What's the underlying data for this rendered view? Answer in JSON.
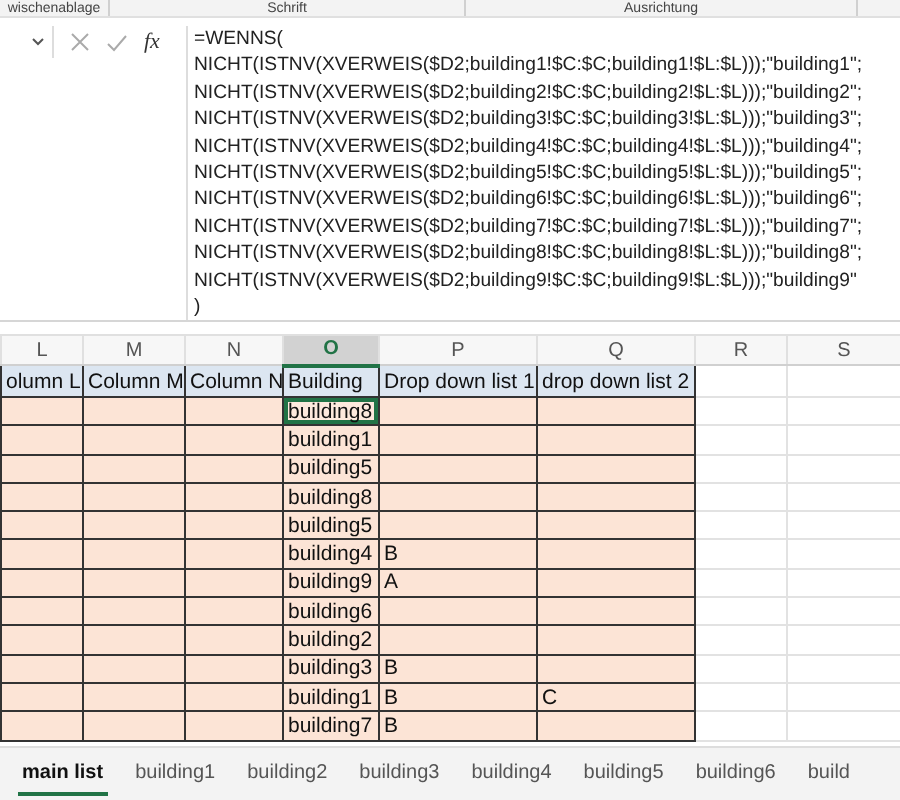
{
  "ribbon_groups": [
    "wischenablage",
    "Schrift",
    "Ausrichtung"
  ],
  "formula_bar": {
    "function_button": "fx",
    "formula_lines": [
      "=WENNS(",
      "NICHT(ISTNV(XVERWEIS($D2;building1!$C:$C;building1!$L:$L)));\"building1\";",
      "NICHT(ISTNV(XVERWEIS($D2;building2!$C:$C;building2!$L:$L)));\"building2\";",
      "NICHT(ISTNV(XVERWEIS($D2;building3!$C:$C;building3!$L:$L)));\"building3\";",
      "NICHT(ISTNV(XVERWEIS($D2;building4!$C:$C;building4!$L:$L)));\"building4\";",
      "NICHT(ISTNV(XVERWEIS($D2;building5!$C:$C;building5!$L:$L)));\"building5\";",
      "NICHT(ISTNV(XVERWEIS($D2;building6!$C:$C;building6!$L:$L)));\"building6\";",
      "NICHT(ISTNV(XVERWEIS($D2;building7!$C:$C;building7!$L:$L)));\"building7\";",
      "NICHT(ISTNV(XVERWEIS($D2;building8!$C:$C;building8!$L:$L)));\"building8\";",
      "NICHT(ISTNV(XVERWEIS($D2;building9!$C:$C;building9!$L:$L)));\"building9\"",
      ")"
    ]
  },
  "column_letters": [
    {
      "label": "L",
      "selected": false
    },
    {
      "label": "M",
      "selected": false
    },
    {
      "label": "N",
      "selected": false
    },
    {
      "label": "O",
      "selected": true
    },
    {
      "label": "P",
      "selected": false
    },
    {
      "label": "Q",
      "selected": false
    },
    {
      "label": "R",
      "selected": false
    },
    {
      "label": "S",
      "selected": false
    }
  ],
  "table": {
    "columns": [
      "olumn L",
      "Column M",
      "Column N",
      "Building",
      "Drop down list 1",
      "drop down list 2"
    ],
    "rows": [
      {
        "building": "building8",
        "list1": "",
        "list2": "",
        "selected": true
      },
      {
        "building": "building1",
        "list1": "",
        "list2": "",
        "selected": false
      },
      {
        "building": "building5",
        "list1": "",
        "list2": "",
        "selected": false
      },
      {
        "building": "building8",
        "list1": "",
        "list2": "",
        "selected": false
      },
      {
        "building": "building5",
        "list1": "",
        "list2": "",
        "selected": false
      },
      {
        "building": "building4",
        "list1": "B",
        "list2": "",
        "selected": false
      },
      {
        "building": "building9",
        "list1": "A",
        "list2": "",
        "selected": false
      },
      {
        "building": "building6",
        "list1": "",
        "list2": "",
        "selected": false
      },
      {
        "building": "building2",
        "list1": "",
        "list2": "",
        "selected": false
      },
      {
        "building": "building3",
        "list1": "B",
        "list2": "",
        "selected": false
      },
      {
        "building": "building1",
        "list1": "B",
        "list2": "C",
        "selected": false
      },
      {
        "building": "building7",
        "list1": "B",
        "list2": "",
        "selected": false
      }
    ]
  },
  "sheet_tabs": [
    {
      "label": "main list",
      "selected": true
    },
    {
      "label": "building1",
      "selected": false
    },
    {
      "label": "building2",
      "selected": false
    },
    {
      "label": "building3",
      "selected": false
    },
    {
      "label": "building4",
      "selected": false
    },
    {
      "label": "building5",
      "selected": false
    },
    {
      "label": "building6",
      "selected": false
    },
    {
      "label": "build",
      "selected": false
    }
  ]
}
